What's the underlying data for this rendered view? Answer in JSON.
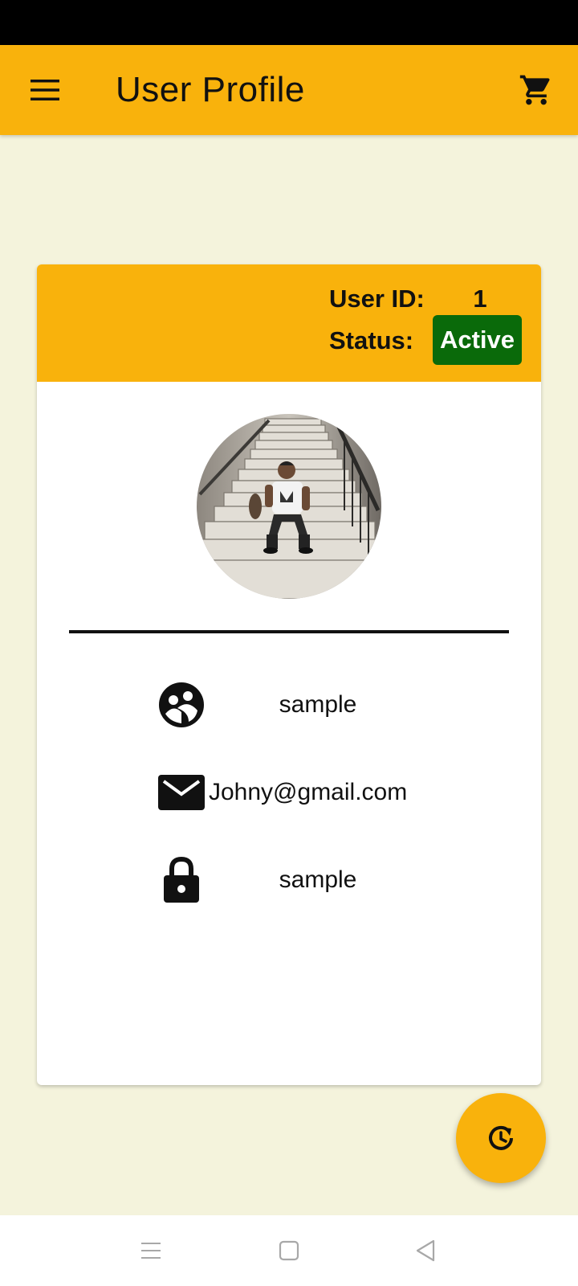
{
  "app_bar": {
    "title": "User Profile",
    "menu_icon": "menu-icon",
    "cart_icon": "cart-icon"
  },
  "header": {
    "user_id_label": "User ID:",
    "user_id_value": "1",
    "status_label": "Status:",
    "status_value": "Active",
    "status_color": "#0a6a0a"
  },
  "profile": {
    "avatar_alt": "profile photo",
    "fields": [
      {
        "icon": "people-icon",
        "value": "sample"
      },
      {
        "icon": "mail-icon",
        "value": "Johny@gmail.com"
      },
      {
        "icon": "lock-icon",
        "value": "sample"
      }
    ]
  },
  "fab": {
    "icon": "history-refresh-icon"
  },
  "nav": {
    "buttons": [
      "recents-icon",
      "home-icon",
      "back-icon"
    ]
  },
  "colors": {
    "accent": "#f9b20c",
    "background": "#f4f3dc",
    "status_active": "#0a6a0a"
  }
}
